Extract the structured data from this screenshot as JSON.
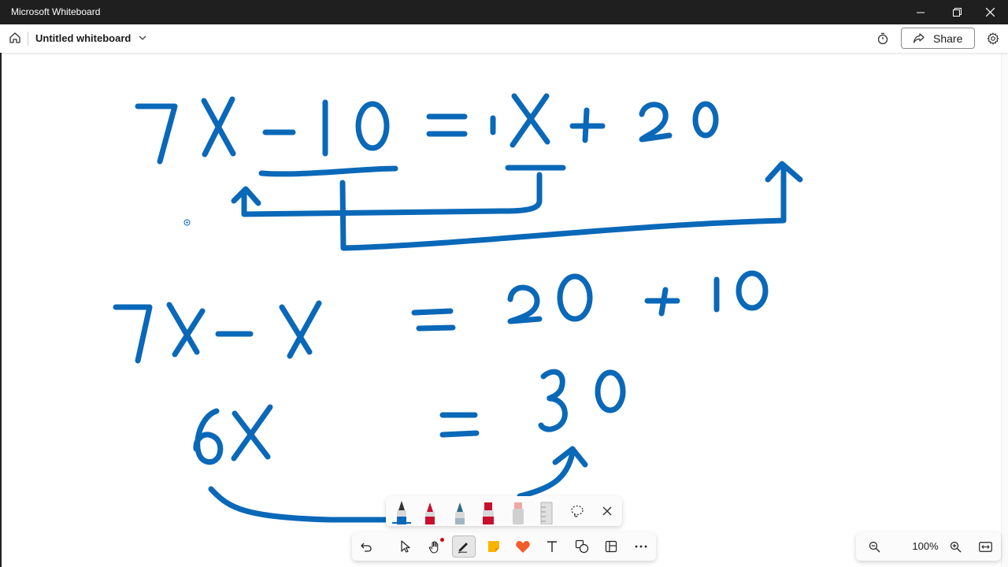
{
  "window": {
    "title": "Microsoft Whiteboard"
  },
  "header": {
    "board_title": "Untitled whiteboard",
    "share_label": "Share"
  },
  "canvas": {
    "ink_color": "#0a68b8",
    "equations": [
      "7X - 10 = X + 20",
      "7X - X = 20 + 10",
      "6X = 30"
    ]
  },
  "zoom": {
    "level": "100%"
  },
  "icons": {
    "home": "home-icon",
    "timer": "timer-icon",
    "share": "share-icon",
    "settings": "gear-icon"
  },
  "colors": {
    "titlebar": "#1f1f1f",
    "ink": "#0a68b8",
    "sticky_note": "#f7b500",
    "reaction": "#f25c2a"
  }
}
